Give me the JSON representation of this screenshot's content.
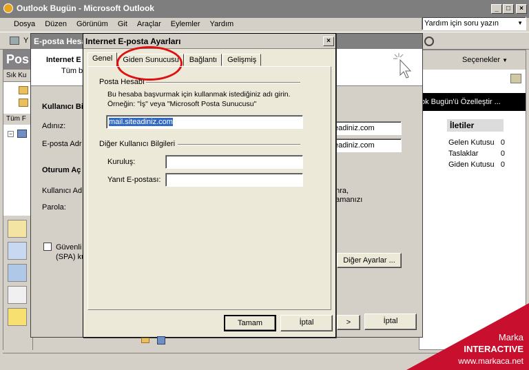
{
  "main_window": {
    "title": "Outlook Bugün - Microsoft Outlook",
    "controls": {
      "minimize": "_",
      "maximize": "□",
      "close": "×"
    }
  },
  "menu": [
    "Dosya",
    "Düzen",
    "Görünüm",
    "Git",
    "Araçlar",
    "Eylemler",
    "Yardım"
  ],
  "help_search": {
    "placeholder": "Yardım için soru yazın"
  },
  "toolbar": {
    "y_label": "Y"
  },
  "nav": {
    "header": "Pos",
    "subheader": "Sık Ku",
    "all_label": "Tüm F"
  },
  "outlook_today": {
    "options_label": "Seçenekler",
    "customize_label": "ok Bugün'ü Özelleştir ...",
    "messages_header": "İletiler",
    "messages": [
      {
        "name": "Gelen Kutusu",
        "count": "0"
      },
      {
        "name": "Taslaklar",
        "count": "0"
      },
      {
        "name": "Giden Kutusu",
        "count": "0"
      }
    ]
  },
  "account_dialog": {
    "title": "E-posta Hesa",
    "header1": "Internet E",
    "header2": "Tüm bu",
    "user_info": "Kullanıcı Bi",
    "name_label": "Adınız:",
    "email_label": "E-posta Adr",
    "email_value1": "eadiniz.com",
    "email_value2": "eadiniz.com",
    "logon_header": "Oturum Aç",
    "username_label": "Kullanıcı Adı",
    "password_label": "Parola:",
    "spa_label1": "Güvenli P",
    "spa_label2": "(SPA) ku",
    "text_right1": "onra,",
    "text_right2": "hamanızı",
    "other_settings": "Diğer Ayarlar ...",
    "cancel_button": "İptal",
    "next_button": ">"
  },
  "settings_dialog": {
    "title": "Internet E-posta Ayarları",
    "close": "×",
    "tabs": [
      "Genel",
      "Giden Sunucusu",
      "Bağlantı",
      "Gelişmiş"
    ],
    "mail_account_group": "Posta Hesabı",
    "description": "Bu hesaba başvurmak için kullanmak istediğiniz adı girin.",
    "example": "Örneğin: \"İş\" veya \"Microsoft Posta Sunucusu\"",
    "account_value": "mail.siteadiniz.com",
    "other_user_group": "Diğer Kullanıcı Bilgileri",
    "organization_label": "Kuruluş:",
    "reply_label": "Yanıt E-postası:",
    "ok_button": "Tamam",
    "cancel_button": "İptal"
  },
  "watermark": {
    "line1": "Marka",
    "line2": "INTERACTIVE",
    "line3": "www.markaca.net"
  }
}
